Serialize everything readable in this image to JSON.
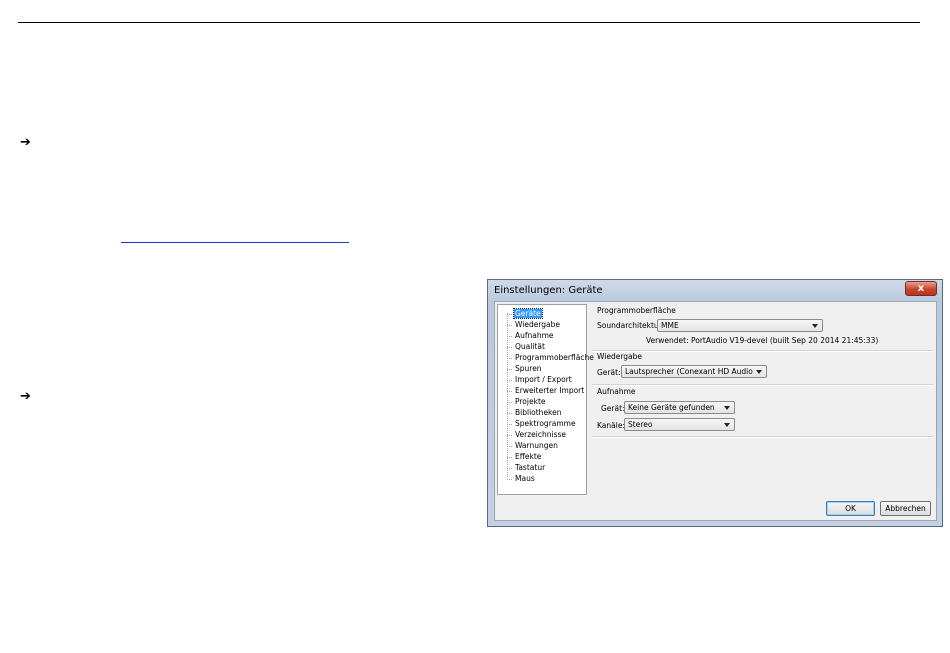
{
  "dialog": {
    "title": "Einstellungen: Geräte",
    "close_label": "x",
    "tree": [
      "Geräte",
      "Wiedergabe",
      "Aufnahme",
      "Qualität",
      "Programmoberfläche",
      "Spuren",
      "Import / Export",
      "Erweiterter Import",
      "Projekte",
      "Bibliotheken",
      "Spektrogramme",
      "Verzeichnisse",
      "Warnungen",
      "Effekte",
      "Tastatur",
      "Maus"
    ],
    "interface": {
      "title": "Programmoberfläche",
      "host_label": "Soundarchitektur:",
      "host_value": "MME",
      "using_text": "Verwendet: PortAudio V19-devel (built Sep 20 2014 21:45:33)"
    },
    "playback": {
      "title": "Wiedergabe",
      "device_label": "Gerät:",
      "device_value": "Lautsprecher (Conexant HD Audio"
    },
    "recording": {
      "title": "Aufnahme",
      "device_label": "Gerät:",
      "device_value": "Keine Geräte gefunden",
      "channels_label": "Kanäle:",
      "channels_value": "Stereo"
    },
    "ok_label": "OK",
    "cancel_label": "Abbrechen"
  },
  "doc": {
    "arrow_1": "Ð",
    "arrow_2": "Ð"
  }
}
